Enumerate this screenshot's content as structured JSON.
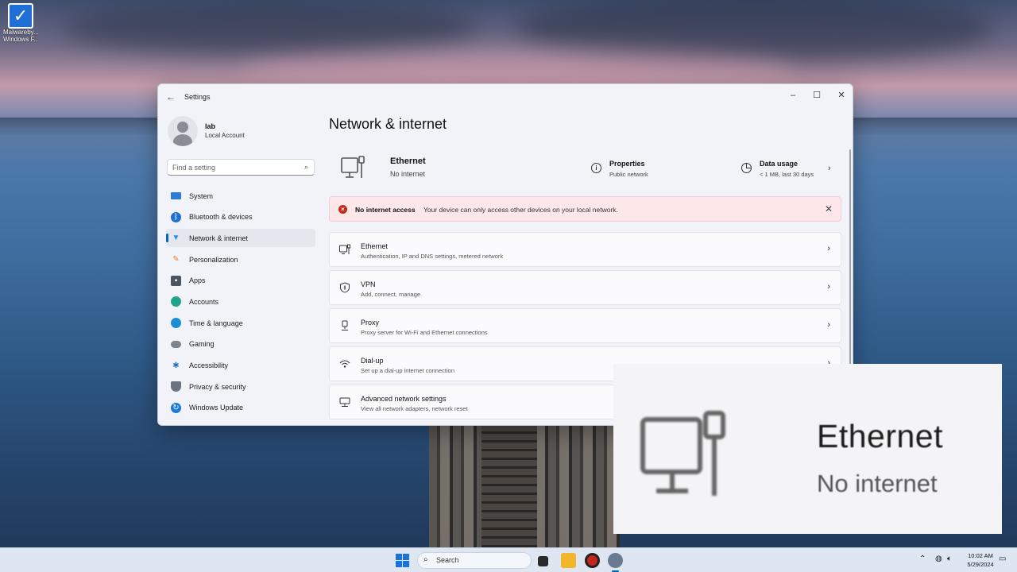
{
  "desktop": {
    "icon_label_line1": "Malwareby...",
    "icon_label_line2": "Windows F..."
  },
  "window": {
    "title": "Settings",
    "minimize_glyph": "–",
    "maximize_glyph": "☐",
    "close_glyph": "✕"
  },
  "profile": {
    "name": "lab",
    "account_type": "Local Account"
  },
  "search": {
    "placeholder": "Find a setting"
  },
  "sidebar": {
    "items": [
      {
        "label": "System",
        "icon": "system-icon",
        "color": "#2b7cd3"
      },
      {
        "label": "Bluetooth & devices",
        "icon": "bluetooth-icon",
        "color": "#1f6fd6"
      },
      {
        "label": "Network & internet",
        "icon": "wifi-icon",
        "color": "#2b8be6",
        "active": true
      },
      {
        "label": "Personalization",
        "icon": "brush-icon",
        "color": "#e0892b"
      },
      {
        "label": "Apps",
        "icon": "apps-icon",
        "color": "#4a5563"
      },
      {
        "label": "Accounts",
        "icon": "person-icon",
        "color": "#1fa38a"
      },
      {
        "label": "Time & language",
        "icon": "globe-clock-icon",
        "color": "#1b8fd6"
      },
      {
        "label": "Gaming",
        "icon": "controller-icon",
        "color": "#7d8590"
      },
      {
        "label": "Accessibility",
        "icon": "accessibility-icon",
        "color": "#1f6fd6"
      },
      {
        "label": "Privacy & security",
        "icon": "shield-icon",
        "color": "#6b7280"
      },
      {
        "label": "Windows Update",
        "icon": "update-icon",
        "color": "#1b78d6"
      }
    ]
  },
  "main": {
    "page_title": "Network & internet",
    "hero": {
      "name": "Ethernet",
      "status": "No internet",
      "properties_title": "Properties",
      "properties_sub": "Public network",
      "usage_title": "Data usage",
      "usage_sub": "< 1 MB, last 30 days"
    },
    "alert": {
      "title": "No internet access",
      "message": "Your device can only access other devices on your local network."
    },
    "cards": [
      {
        "title": "Ethernet",
        "subtitle": "Authentication, IP and DNS settings, metered network",
        "icon": "ethernet-icon"
      },
      {
        "title": "VPN",
        "subtitle": "Add, connect, manage",
        "icon": "vpn-shield-icon"
      },
      {
        "title": "Proxy",
        "subtitle": "Proxy server for Wi-Fi and Ethernet connections",
        "icon": "proxy-icon"
      },
      {
        "title": "Dial-up",
        "subtitle": "Set up a dial-up internet connection",
        "icon": "dialup-icon"
      },
      {
        "title": "Advanced network settings",
        "subtitle": "View all network adapters, network reset",
        "icon": "network-adapter-icon"
      }
    ]
  },
  "zoom_inset": {
    "name": "Ethernet",
    "status": "No internet"
  },
  "taskbar": {
    "search_label": "Search",
    "time": "10:02 AM",
    "date": "5/29/2024"
  }
}
